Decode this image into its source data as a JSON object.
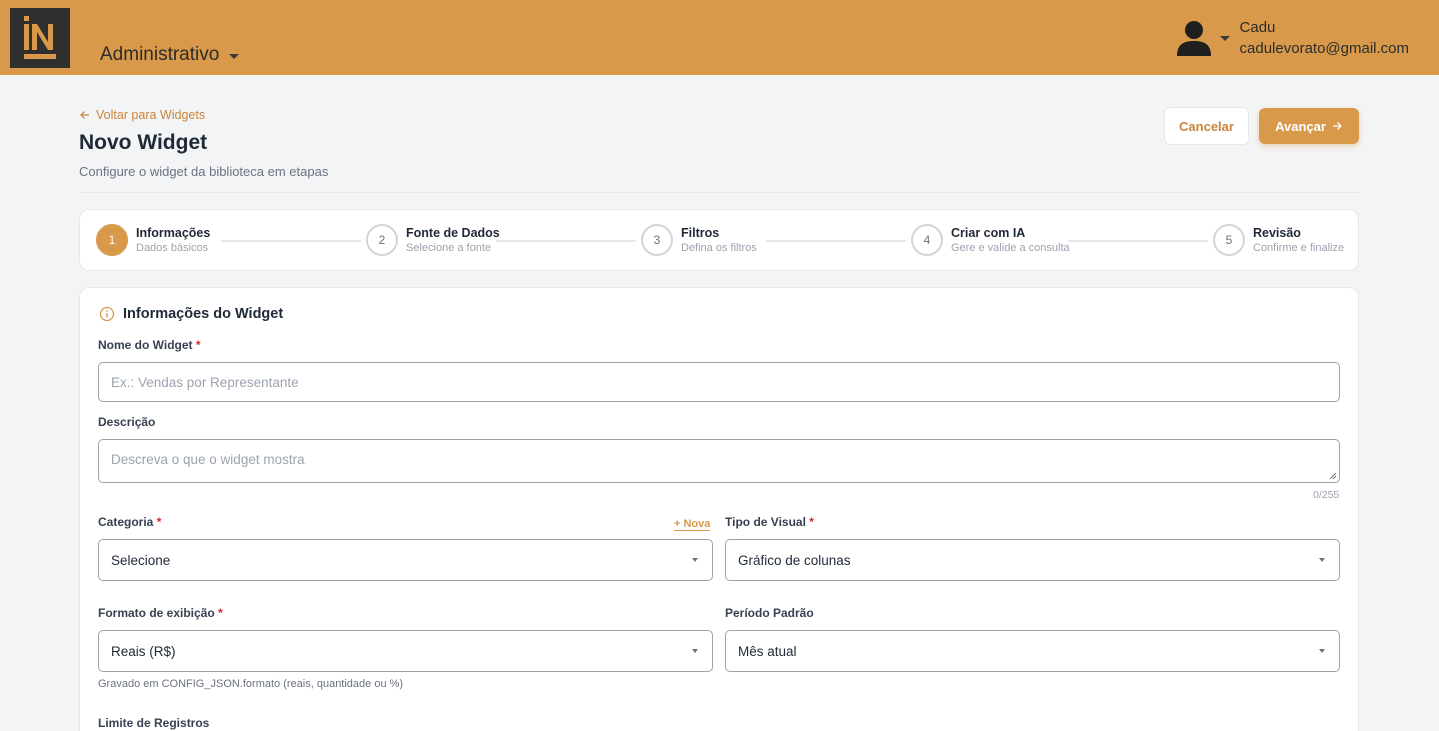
{
  "header": {
    "module": "Administrativo",
    "user_name": "Cadu",
    "user_email": "cadulevorato@gmail.com"
  },
  "page": {
    "back_link": "Voltar para Widgets",
    "title": "Novo Widget",
    "subtitle": "Configure o widget da biblioteca em etapas",
    "cancel_label": "Cancelar",
    "next_label": "Avançar"
  },
  "stepper": {
    "steps": [
      {
        "number": "1",
        "title": "Informações",
        "desc": "Dados básicos"
      },
      {
        "number": "2",
        "title": "Fonte de Dados",
        "desc": "Selecione a fonte"
      },
      {
        "number": "3",
        "title": "Filtros",
        "desc": "Defina os filtros"
      },
      {
        "number": "4",
        "title": "Criar com IA",
        "desc": "Gere e valide a consulta"
      },
      {
        "number": "5",
        "title": "Revisão",
        "desc": "Confirme e finalize"
      }
    ]
  },
  "form": {
    "section_title": "Informações do Widget",
    "name_label": "Nome do Widget",
    "name_placeholder": "Ex.: Vendas por Representante",
    "desc_label": "Descrição",
    "desc_placeholder": "Descreva o que o widget mostra",
    "desc_counter": "0/255",
    "category_label": "Categoria",
    "category_new": "+ Nova",
    "category_value": "Selecione",
    "visual_label": "Tipo de Visual",
    "visual_value": "Gráfico de colunas",
    "format_label": "Formato de exibição",
    "format_value": "Reais (R$)",
    "format_hint": "Gravado em CONFIG_JSON.formato (reais, quantidade ou %)",
    "period_label": "Período Padrão",
    "period_value": "Mês atual",
    "limit_label": "Limite de Registros",
    "required_mark": "*"
  },
  "colors": {
    "accent": "#d89a4a",
    "accent_text": "#c9853a",
    "required": "#dc2626"
  }
}
